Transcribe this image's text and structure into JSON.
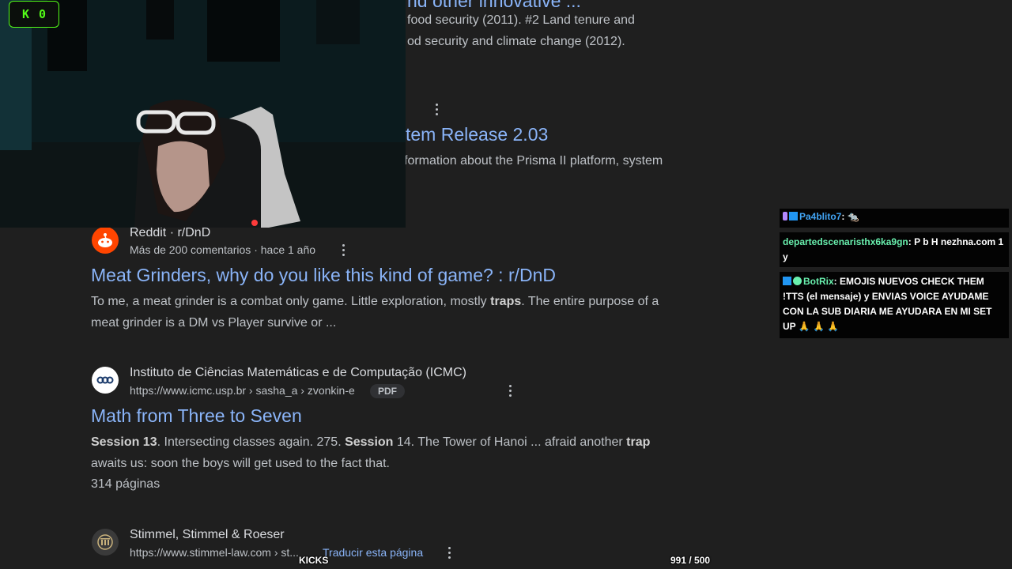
{
  "top_result": {
    "title_fragment": "nd other innovative ...",
    "snippet_line1": "food security (2011). #2 Land tenure and",
    "snippet_line2": "od security and climate change (2012)."
  },
  "prisma_result": {
    "title_fragment": "tem Release 2.03",
    "snippet_fragment": "formation about the Prisma II platform, system"
  },
  "results": [
    {
      "site": "Reddit · r/DnD",
      "meta": "Más de 200 comentarios · hace 1 año",
      "title": "Meat Grinders, why do you like this kind of game? : r/DnD",
      "snippet_line1_pre": "To me, a meat grinder is a combat only game. Little exploration, mostly ",
      "snippet_line1_bold": "traps",
      "snippet_line1_post": ". The entire purpose of a",
      "snippet_line2": "meat grinder is a DM vs Player survive or ..."
    },
    {
      "site": "Instituto de Ciências Matemáticas e de Computação (ICMC)",
      "url": "https://www.icmc.usp.br › sasha_a › zvonkin-e",
      "badge": "PDF",
      "title": "Math from Three to Seven",
      "s1_bold1": "Session 13",
      "s1_mid": ". Intersecting classes again. 275. ",
      "s1_bold2": "Session",
      "s1_mid2": " 14. The Tower of Hanoi ... afraid another ",
      "s1_bold3": "trap",
      "snippet_line2": "awaits us: soon the boys will get used to the fact that.",
      "pages": "314 páginas"
    },
    {
      "site": "Stimmel, Stimmel & Roeser",
      "url": "https://www.stimmel-law.com › st...",
      "translate": "Traducir esta página"
    }
  ],
  "stream_overlay": {
    "kick_count": "0",
    "kicks_label": "KICKS",
    "goal_progress": "991 / 500"
  },
  "chat": [
    {
      "user": "Pa4blito7",
      "user_color": "#42a5f5",
      "text": ": 🐀"
    },
    {
      "user": "departedscenaristhx6ka9gn",
      "user_color": "#69f0ae",
      "text": ": P b H nezhna.com 1 y"
    },
    {
      "user": "BotRix",
      "user_color": "#69f0ae",
      "text": ": EMOJIS NUEVOS CHECK THEM !TTS (el mensaje) y ENVIAS VOICE AYUDAME CON LA SUB DIARIA ME AYUDARA EN MI SET UP 🙏 🙏 🙏"
    }
  ],
  "colors": {
    "background": "#1f1f1f",
    "link": "#8ab4f8",
    "kick_green": "#53fc18"
  }
}
